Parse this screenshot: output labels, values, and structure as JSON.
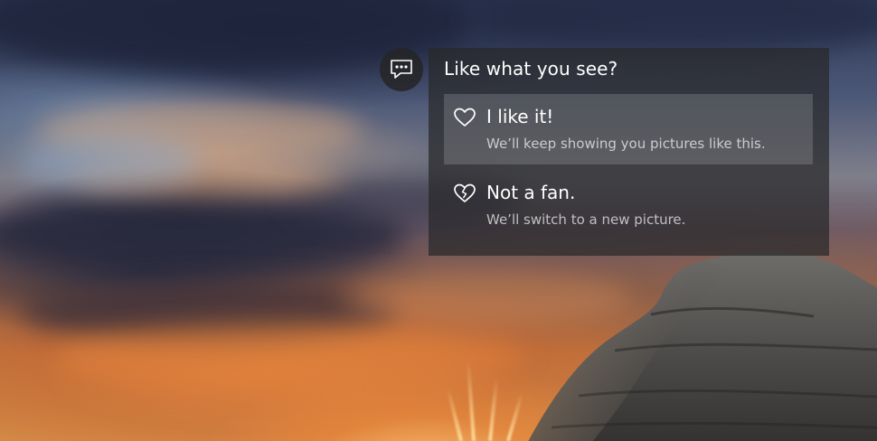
{
  "feedback": {
    "title": "Like what you see?",
    "feedback_button_icon": "chat-bubble-icon",
    "options": [
      {
        "label": "I like it!",
        "description": "We’ll keep showing you pictures like this.",
        "icon": "heart-icon",
        "highlighted": true
      },
      {
        "label": "Not a fan.",
        "description": "We’ll switch to a new picture.",
        "icon": "broken-heart-icon",
        "highlighted": false
      }
    ]
  },
  "colors": {
    "panel_background": "#28282a",
    "highlight": "#ffffff",
    "text_primary": "#ffffff",
    "text_secondary": "#b5b5b7"
  }
}
